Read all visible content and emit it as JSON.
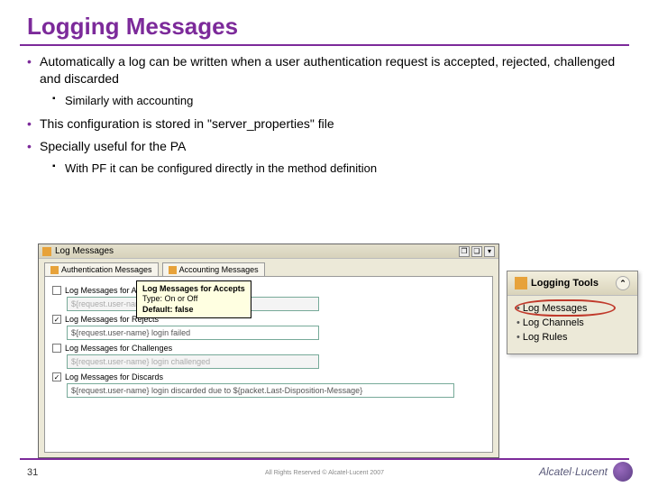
{
  "title": "Logging Messages",
  "bullets": {
    "b1": "Automatically a log can be written when a user authentication request is accepted, rejected, challenged and discarded",
    "b1a": "Similarly with accounting",
    "b2": "This configuration is stored in \"server_properties\" file",
    "b3": "Specially useful for the PA",
    "b3a": "With PF it can be configured directly in the method definition"
  },
  "window": {
    "title": "Log Messages",
    "tabs": {
      "t1": "Authentication Messages",
      "t2": "Accounting Messages"
    },
    "rows": {
      "accepts_label": "Log Messages for Accepts",
      "accepts_field": "${request.user-name}",
      "rejects_label": "Log Messages for Rejects",
      "rejects_field": "${request.user-name} login failed",
      "challenges_label": "Log Messages for Challenges",
      "challenges_field": "${request.user-name} login challenged",
      "discards_label": "Log Messages for Discards",
      "discards_field": "${request.user-name} login discarded due to ${packet.Last-Disposition-Message}"
    },
    "tooltip": {
      "heading": "Log Messages for Accepts",
      "type": "Type: On or Off",
      "def": "Default: false"
    }
  },
  "palette": {
    "title": "Logging Tools",
    "items": {
      "i1": "Log Messages",
      "i2": "Log Channels",
      "i3": "Log Rules"
    }
  },
  "footer": {
    "page": "31",
    "copyright": "All Rights Reserved © Alcatel-Lucent 2007",
    "brand": "Alcatel·Lucent"
  }
}
